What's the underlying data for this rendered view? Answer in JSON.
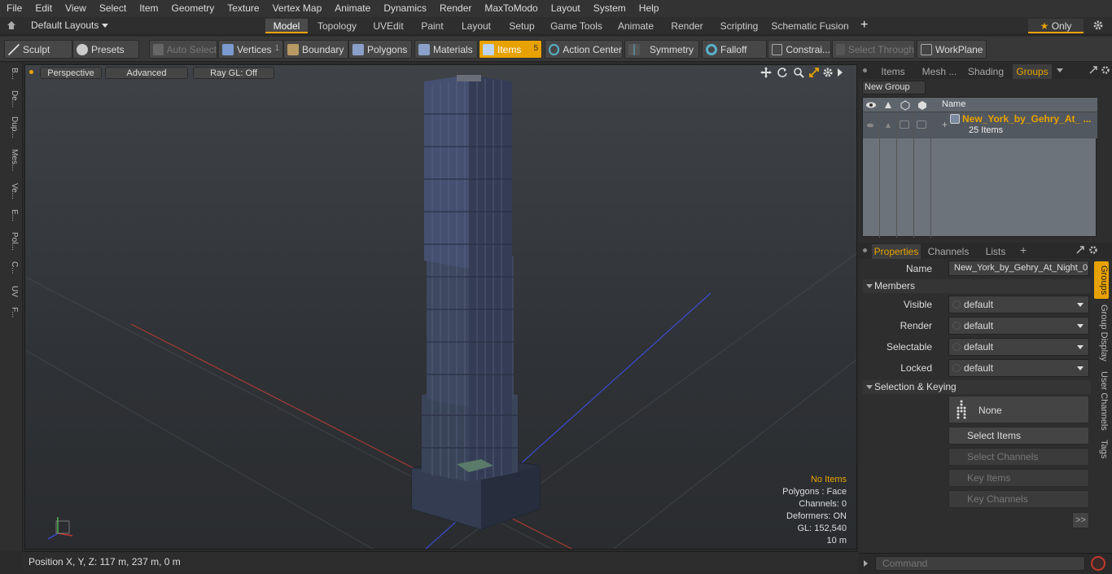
{
  "menu": [
    "File",
    "Edit",
    "View",
    "Select",
    "Item",
    "Geometry",
    "Texture",
    "Vertex Map",
    "Animate",
    "Dynamics",
    "Render",
    "MaxToModo",
    "Layout",
    "System",
    "Help"
  ],
  "layout_selector": "Default Layouts",
  "layout_tabs": [
    "Model",
    "Topology",
    "UVEdit",
    "Paint",
    "Layout",
    "Setup",
    "Game Tools",
    "Animate",
    "Render",
    "Scripting",
    "Schematic Fusion"
  ],
  "only_label": "Only",
  "toolbar": {
    "sculpt": "Sculpt",
    "presets": "Presets",
    "auto_select": "Auto Select",
    "vertices": "Vertices",
    "vertices_count": "1",
    "boundary": "Boundary",
    "polygons": "Polygons",
    "materials": "Materials",
    "items": "Items",
    "items_count": "5",
    "action_center": "Action Center",
    "symmetry": "Symmetry",
    "falloff": "Falloff",
    "constraints": "Constrai...",
    "select_through": "Select Through",
    "workplane": "WorkPlane"
  },
  "left_tabs": [
    "B...",
    "De...",
    "Dup...",
    "Mes...",
    "Ve...",
    "E...",
    "Pol...",
    "C...",
    "UV",
    "F..."
  ],
  "viewport": {
    "perspective": "Perspective",
    "advanced": "Advanced",
    "raygl": "Ray GL: Off",
    "info": {
      "no_items": "No Items",
      "polygons": "Polygons : Face",
      "channels": "Channels: 0",
      "deformers": "Deformers: ON",
      "gl": "GL: 152,540",
      "scale": "10 m"
    }
  },
  "status": "Position X, Y, Z:   117 m, 237 m, 0 m",
  "top_panel": {
    "tabs": [
      "Items",
      "Mesh ...",
      "Shading",
      "Groups"
    ],
    "new_group": "New Group",
    "name_header": "Name",
    "group_name": "New_York_by_Gehry_At_ ...",
    "group_count": "25 Items"
  },
  "properties": {
    "tabs": [
      "Properties",
      "Channels",
      "Lists"
    ],
    "name_label": "Name",
    "name_value": "New_York_by_Gehry_At_Night_0",
    "members_header": "Members",
    "rows": [
      {
        "label": "Visible",
        "value": "default"
      },
      {
        "label": "Render",
        "value": "default"
      },
      {
        "label": "Selectable",
        "value": "default"
      },
      {
        "label": "Locked",
        "value": "default"
      }
    ],
    "selkey_header": "Selection & Keying",
    "none_label": "None",
    "select_items": "Select Items",
    "select_channels": "Select Channels",
    "key_items": "Key Items",
    "key_channels": "Key Channels",
    "more": ">>",
    "side_tabs": [
      "Groups",
      "Group Display",
      "User Channels",
      "Tags"
    ]
  },
  "command_placeholder": "Command",
  "colors": {
    "accent": "#e8a200",
    "x_axis": "#c0392b",
    "z_axis": "#3b4bd1"
  }
}
